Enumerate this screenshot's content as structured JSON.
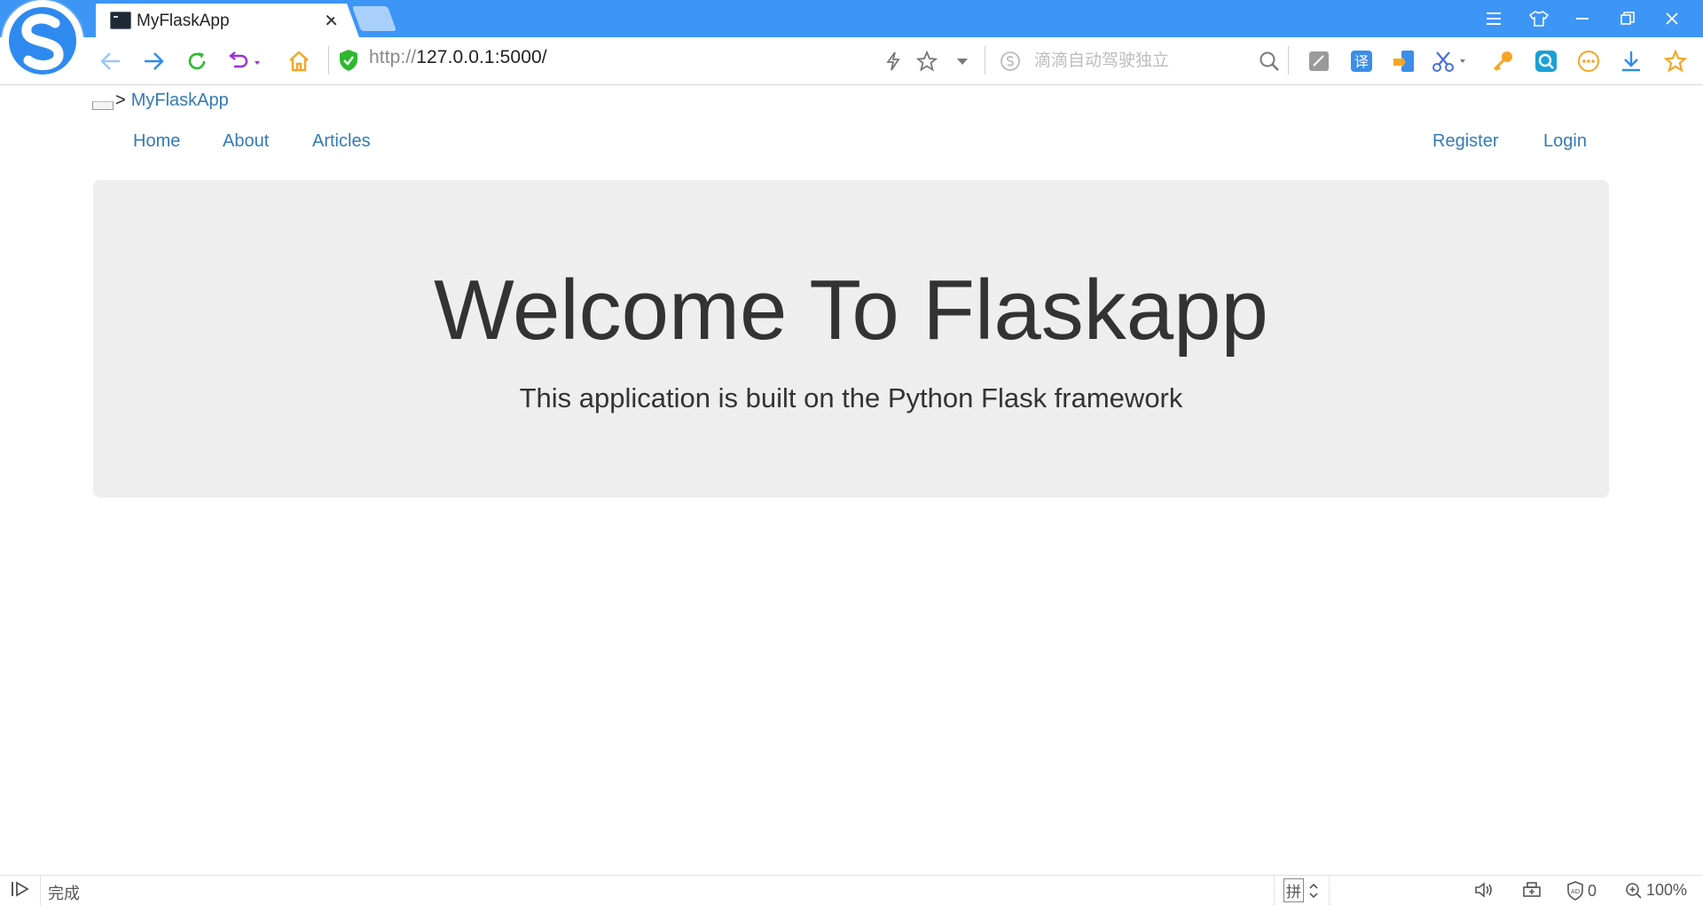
{
  "browser": {
    "tab": {
      "title": "MyFlaskApp",
      "close_glyph": "✕"
    },
    "address": {
      "scheme": "http://",
      "host": "127.0.0.1:5000/"
    },
    "search": {
      "placeholder": "滴滴自动驾驶独立"
    },
    "icons": {
      "logo": "sogou-browser-logo",
      "back": "back-arrow-icon",
      "forward": "forward-arrow-icon",
      "refresh": "refresh-icon",
      "undo": "undo-close-icon",
      "home": "home-icon",
      "secure": "shield-check-icon",
      "speed": "lightning-icon",
      "favorite": "star-outline-icon",
      "dropdown": "chevron-down-icon",
      "search_engine": "sogou-search-icon",
      "search": "magnifier-icon",
      "ext": [
        "screenshot-icon",
        "translate-icon",
        "phone-send-icon",
        "scissors-icon",
        "key-icon",
        "qr-scan-icon",
        "more-icon",
        "download-icon",
        "star-filled-icon"
      ]
    },
    "ext_translate_label": "译",
    "colors": {
      "titlebar": "#3d95f5",
      "accent_green": "#2eb82e",
      "accent_orange": "#f5a623",
      "link": "#337ab7"
    }
  },
  "page": {
    "brand": {
      "prefix": ">",
      "label": "MyFlaskApp"
    },
    "nav": {
      "left": [
        "Home",
        "About",
        "Articles"
      ],
      "right": [
        "Register",
        "Login"
      ]
    },
    "jumbotron": {
      "title": "Welcome To Flaskapp",
      "subtitle": "This application is built on the Python Flask framework"
    }
  },
  "status": {
    "text": "完成",
    "ime": "拼",
    "adblock_count": "0",
    "zoom": "100%"
  }
}
